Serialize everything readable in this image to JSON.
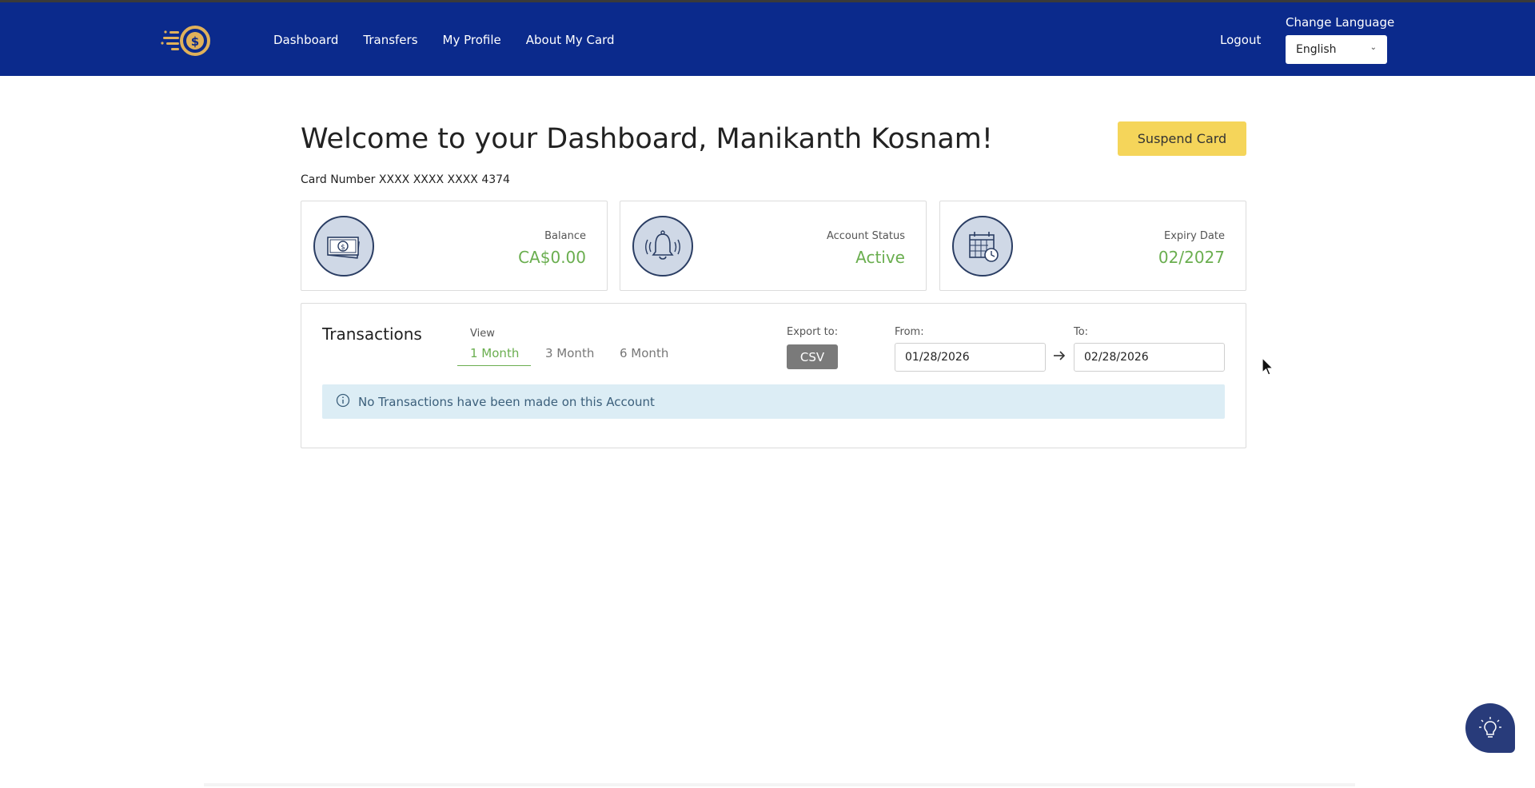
{
  "navbar": {
    "links": [
      "Dashboard",
      "Transfers",
      "My Profile",
      "About My Card"
    ],
    "logout_label": "Logout",
    "language_label": "Change Language",
    "language_value": "English",
    "logo_icon": "dollar-coin-speed-icon",
    "background_color": "#0b2a8c",
    "logo_color": "#e0b15a"
  },
  "main": {
    "welcome": "Welcome to your Dashboard, Manikanth Kosnam!",
    "suspend_label": "Suspend Card",
    "card_number": "Card Number XXXX XXXX XXXX 4374",
    "accent_color": "#f5d55a",
    "cards": [
      {
        "label": "Balance",
        "value": "CA$0.00",
        "icon": "cash-icon"
      },
      {
        "label": "Account Status",
        "value": "Active",
        "icon": "bell-icon"
      },
      {
        "label": "Expiry Date",
        "value": "02/2027",
        "icon": "calendar-clock-icon"
      }
    ],
    "value_color": "#6aae4f"
  },
  "transactions": {
    "title": "Transactions",
    "view_label": "View",
    "tabs": [
      "1 Month",
      "3 Month",
      "6 Month"
    ],
    "active_tab": "1 Month",
    "export_label": "Export to:",
    "csv_label": "CSV",
    "from_label": "From:",
    "from_value": "01/28/2026",
    "to_label": "To:",
    "to_value": "02/28/2026",
    "empty_message": "No Transactions have been made on this Account",
    "info_icon": "info-icon"
  },
  "help_fab_icon": "lightbulb-icon"
}
